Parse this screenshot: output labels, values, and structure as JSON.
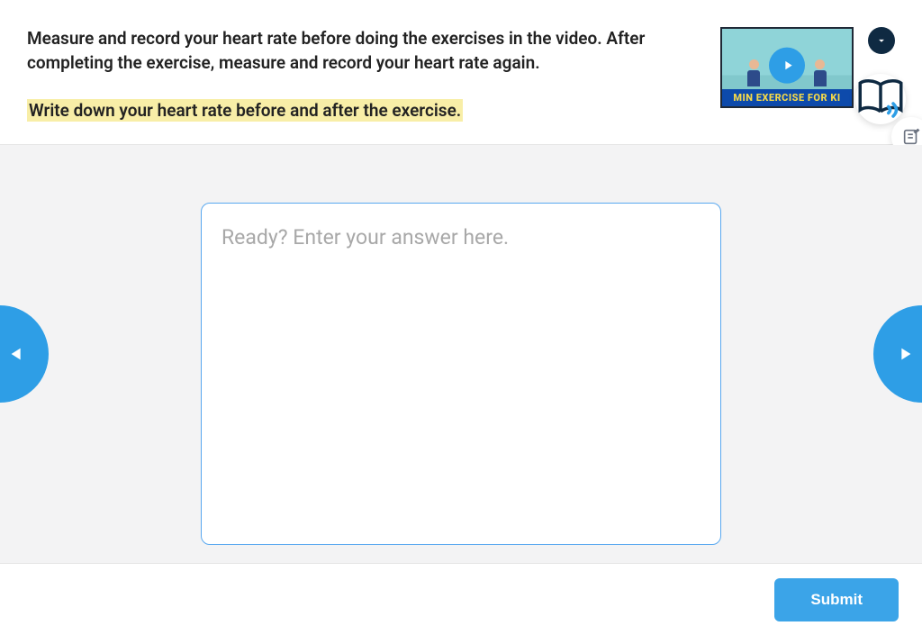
{
  "question": {
    "instructions": "Measure and record your heart rate before doing the exercises in the video. After completing the exercise, measure and record your heart rate again.",
    "highlighted_prompt": "Write down your heart rate before and after the exercise."
  },
  "video": {
    "caption": "MIN EXERCISE FOR KI"
  },
  "answer": {
    "placeholder": "Ready? Enter your answer here.",
    "value": ""
  },
  "footer": {
    "submit_label": "Submit"
  },
  "icons": {
    "toggle": "chevron-down",
    "read_aloud": "book-sound",
    "notes": "edit-note",
    "play": "play",
    "prev": "triangle-left",
    "next": "triangle-right"
  }
}
